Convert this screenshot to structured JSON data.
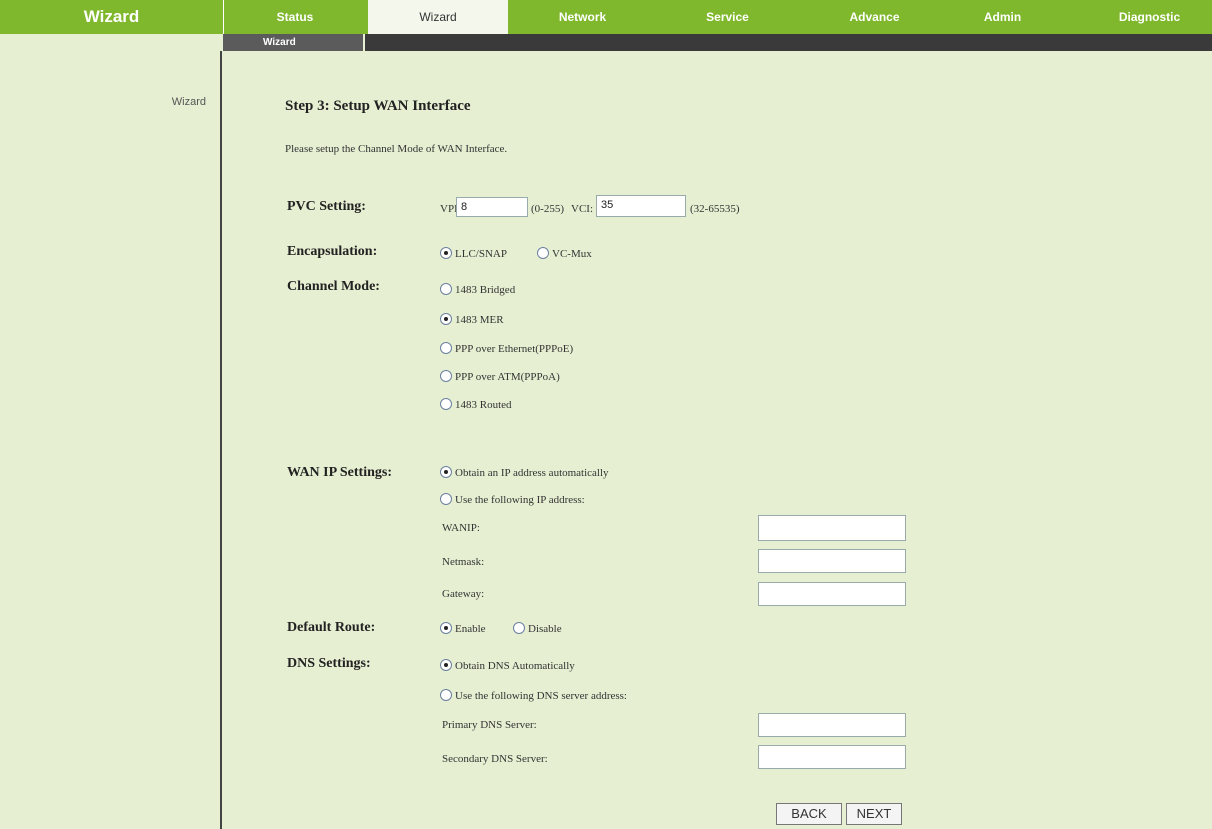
{
  "header": {
    "brand": "Wizard",
    "tabs": [
      "Status",
      "Wizard",
      "Network",
      "Service",
      "Advance",
      "Admin",
      "Diagnostic"
    ],
    "active_tab": "Wizard",
    "subtab": "Wizard"
  },
  "sidebar": {
    "items": [
      "Wizard"
    ]
  },
  "page": {
    "title": "Step 3: Setup WAN Interface",
    "description": "Please setup the Channel Mode of WAN Interface."
  },
  "pvc": {
    "label": "PVC Setting:",
    "vpi_label": "VPI:",
    "vpi_value": "8",
    "vpi_range": "(0-255)",
    "vci_label": "VCI:",
    "vci_value": "35",
    "vci_range": "(32-65535)"
  },
  "encapsulation": {
    "label": "Encapsulation:",
    "options": [
      "LLC/SNAP",
      "VC-Mux"
    ],
    "selected": "LLC/SNAP"
  },
  "channel_mode": {
    "label": "Channel Mode:",
    "options": [
      "1483 Bridged",
      "1483 MER",
      "PPP over Ethernet(PPPoE)",
      "PPP over ATM(PPPoA)",
      "1483 Routed"
    ],
    "selected": "1483 MER"
  },
  "wan_ip": {
    "label": "WAN IP Settings:",
    "options": [
      "Obtain an IP address automatically",
      "Use the following IP address:"
    ],
    "selected": "Obtain an IP address automatically",
    "fields": [
      "WANIP:",
      "Netmask:",
      "Gateway:"
    ]
  },
  "default_route": {
    "label": "Default Route:",
    "options": [
      "Enable",
      "Disable"
    ],
    "selected": "Enable"
  },
  "dns": {
    "label": "DNS Settings:",
    "options": [
      "Obtain DNS Automatically",
      "Use the following DNS server address:"
    ],
    "selected": "Obtain DNS Automatically",
    "fields": [
      "Primary DNS Server:",
      "Secondary DNS Server:"
    ]
  },
  "buttons": {
    "back": "BACK",
    "next": "NEXT"
  },
  "colors": {
    "nav_green": "#7fb82c",
    "page_bg": "#e6efd2",
    "subnav": "#3a3a3a"
  }
}
